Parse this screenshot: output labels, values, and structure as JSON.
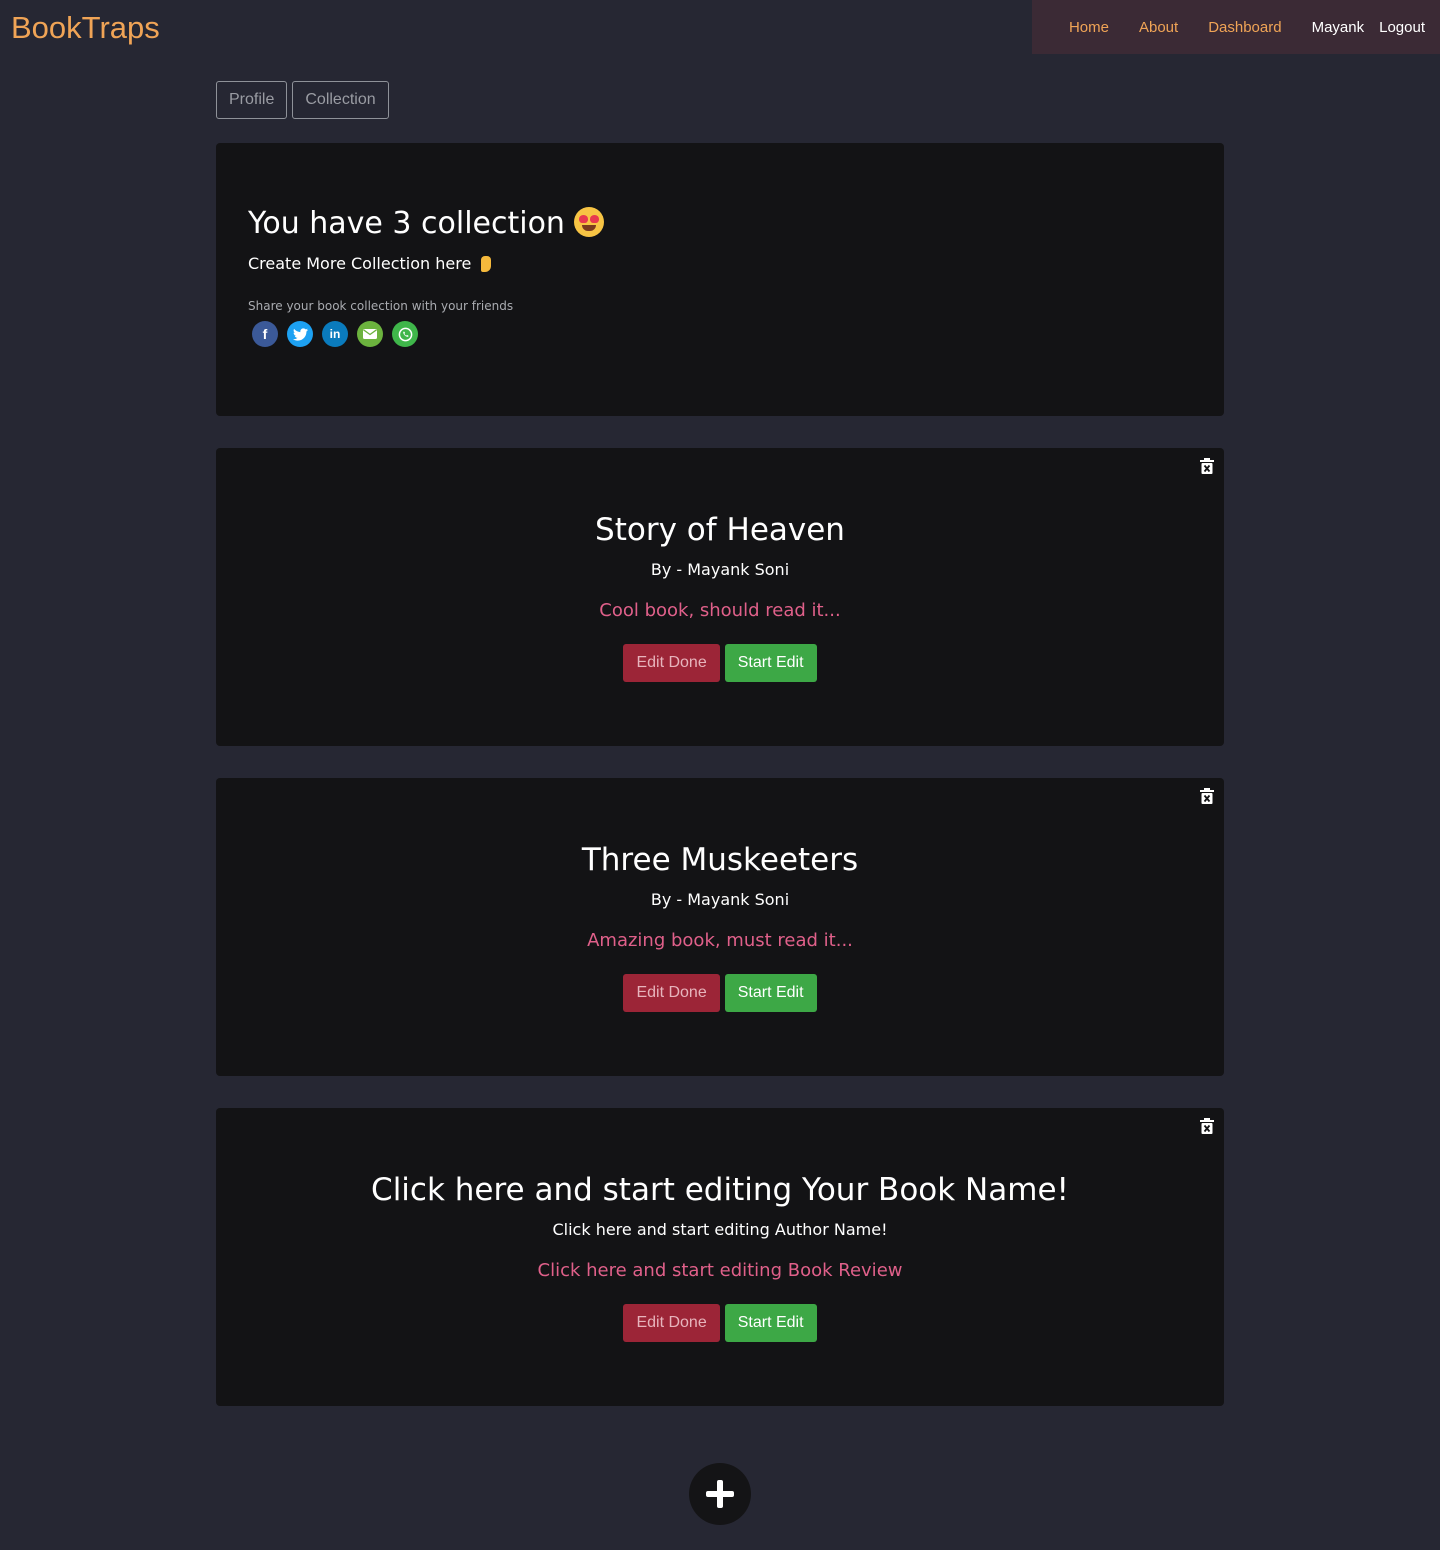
{
  "brand": "BookTraps",
  "nav": {
    "home": "Home",
    "about": "About",
    "dashboard": "Dashboard",
    "user": "Mayank",
    "logout": "Logout"
  },
  "tabs": {
    "profile": "Profile",
    "collection": "Collection"
  },
  "summary": {
    "title": "You have 3 collection",
    "subtitle": "Create More Collection here",
    "share_label": "Share your book collection with your friends",
    "share_icons": [
      "facebook-icon",
      "twitter-icon",
      "linkedin-icon",
      "email-icon",
      "whatsapp-icon"
    ]
  },
  "books": [
    {
      "title": "Story of Heaven",
      "author": "By - Mayank Soni",
      "review": "Cool book, should read it..."
    },
    {
      "title": "Three Muskeeters",
      "author": "By - Mayank Soni",
      "review": "Amazing book, must read it..."
    },
    {
      "title": "Click here and start editing Your Book Name!",
      "author": "Click here and start editing Author Name!",
      "review": "Click here and start editing Book Review"
    }
  ],
  "buttons": {
    "edit_done": "Edit Done",
    "start_edit": "Start Edit"
  },
  "colors": {
    "background": "#262733",
    "card": "#131315",
    "brand": "#f0a456",
    "review": "#e0608a",
    "edit_done": "#9c2537",
    "start_edit": "#3da846"
  }
}
